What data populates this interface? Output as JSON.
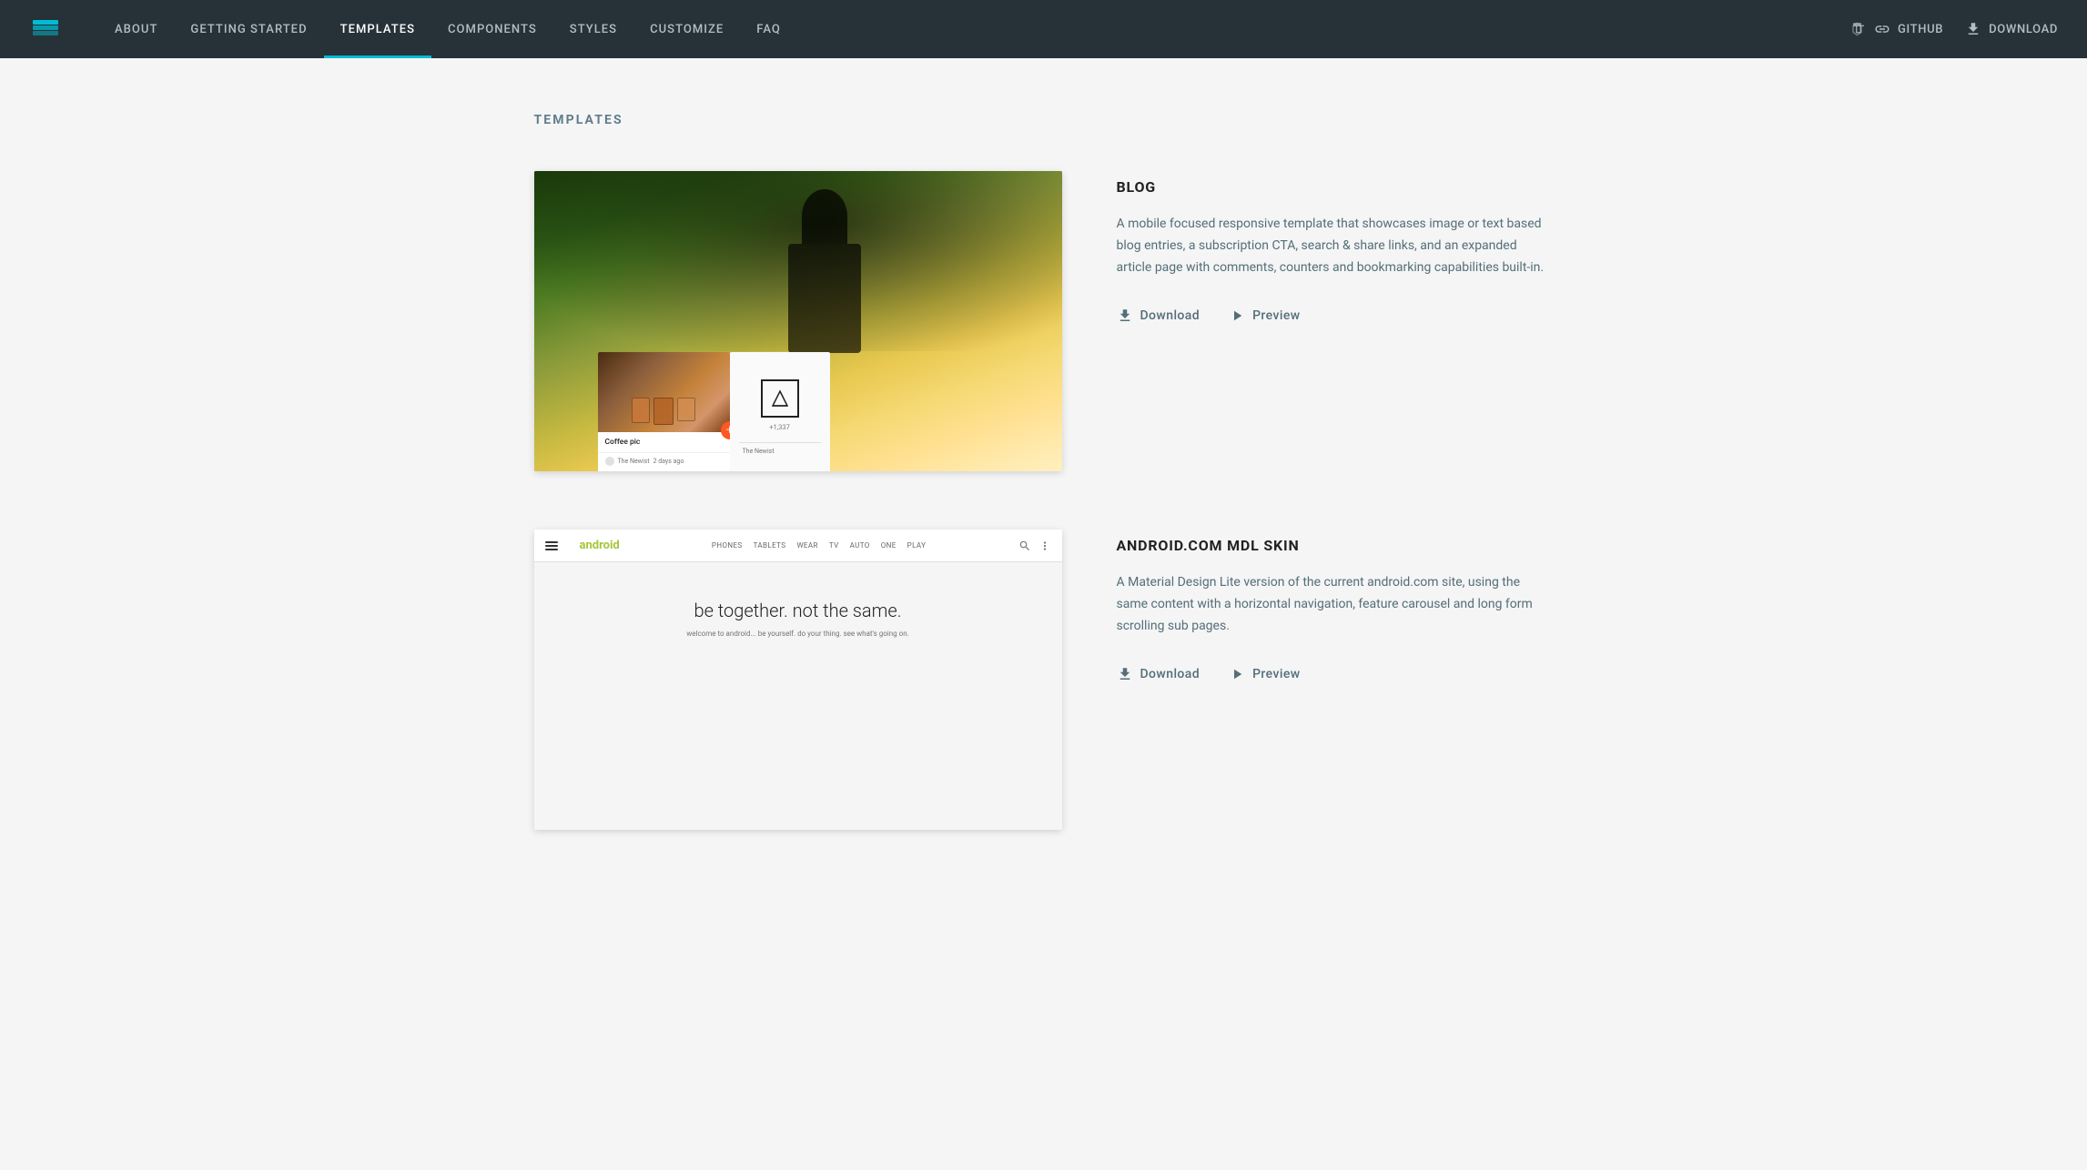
{
  "header": {
    "logo_alt": "MDL Logo",
    "nav_items": [
      {
        "label": "ABOUT",
        "id": "about",
        "active": false
      },
      {
        "label": "GETTING STARTED",
        "id": "getting-started",
        "active": false
      },
      {
        "label": "TEMPLATES",
        "id": "templates",
        "active": true
      },
      {
        "label": "COMPONENTS",
        "id": "components",
        "active": false
      },
      {
        "label": "STYLES",
        "id": "styles",
        "active": false
      },
      {
        "label": "CUSTOMIZE",
        "id": "customize",
        "active": false
      },
      {
        "label": "FAQ",
        "id": "faq",
        "active": false
      }
    ],
    "github_label": "GitHub",
    "download_label": "Download"
  },
  "main": {
    "page_title": "TEMPLATES",
    "templates": [
      {
        "id": "blog",
        "name": "BLOG",
        "description": "A mobile focused responsive template that showcases image or text based blog entries, a subscription CTA, search & share links, and an expanded article page with comments, counters and bookmarking capabilities built-in.",
        "download_label": "Download",
        "preview_label": "Preview",
        "blog_card_caption": "Coffee pic",
        "blog_card_meta": "The Newist",
        "blog_card_meta2": "2 days ago",
        "blog_count": "+1,337"
      },
      {
        "id": "android-mdl",
        "name": "ANDROID.COM MDL SKIN",
        "description": "A Material Design Lite version of the current android.com site, using the same content with a horizontal navigation, feature carousel and long form scrolling sub pages.",
        "download_label": "Download",
        "preview_label": "Preview",
        "android_title": "be together. not the same.",
        "android_sub": "welcome to android... be yourself. do your thing. see what's going on.",
        "android_logo": "android",
        "android_nav_links": [
          "PHONES",
          "TABLETS",
          "WEAR",
          "TV",
          "AUTO",
          "ONE",
          "PLAY"
        ]
      }
    ]
  },
  "colors": {
    "header_bg": "#263238",
    "nav_active_border": "#00bcd4",
    "accent": "#ff5722"
  }
}
